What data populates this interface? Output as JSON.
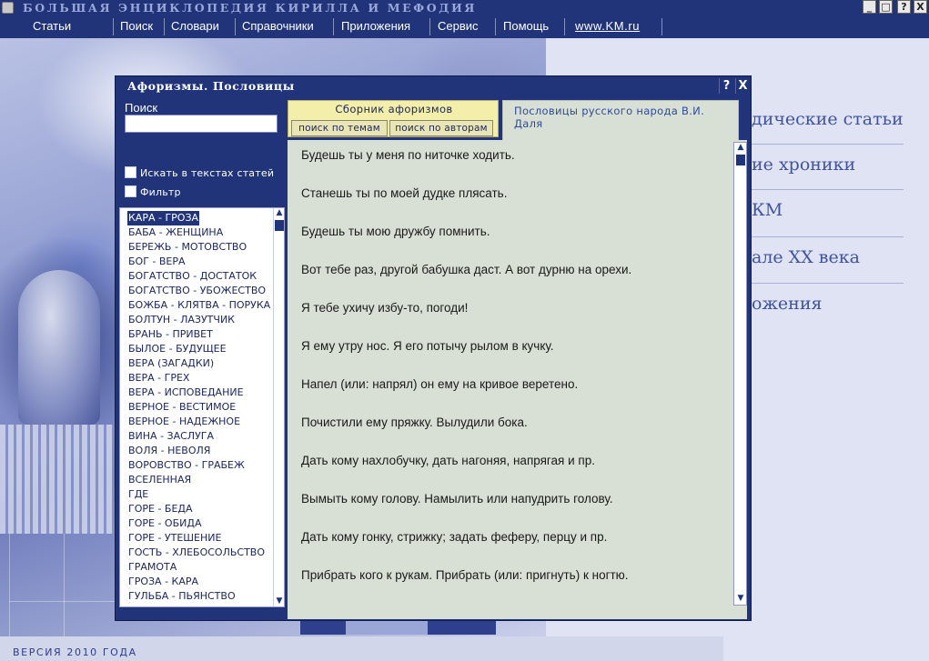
{
  "app": {
    "title": "БОЛЬШАЯ ЭНЦИКЛОПЕДИЯ КИРИЛЛА И МЕФОДИЯ",
    "window_buttons": [
      "_",
      "□",
      "?",
      "X"
    ],
    "version": "ВЕРСИЯ 2010 ГОДА"
  },
  "menu": [
    "Статьи",
    "Поиск",
    "Словари",
    "Справочники",
    "Приложения",
    "Сервис",
    "Помощь",
    "www.KM.ru"
  ],
  "background_links": [
    "дические статьи",
    "ие хроники",
    "КМ",
    "але XX века",
    "ожения"
  ],
  "dialog": {
    "title": "Афоризмы. Пословицы",
    "help": "?",
    "close": "X",
    "search": {
      "label": "Поиск",
      "value": "",
      "options": [
        {
          "label": "Искать в текстах статей",
          "checked": false
        },
        {
          "label": "Фильтр",
          "checked": false
        }
      ]
    },
    "topics": [
      "КАРА - ГРОЗА",
      "БАБА - ЖЕНЩИНА",
      "БЕРЕЖЬ - МОТОВСТВО",
      "БОГ - ВЕРА",
      "БОГАТСТВО - ДОСТАТОК",
      "БОГАТСТВО - УБОЖЕСТВО",
      "БОЖБА - КЛЯТВА - ПОРУКА",
      "БОЛТУН - ЛАЗУТЧИК",
      "БРАНЬ - ПРИВЕТ",
      "БЫЛОЕ - БУДУЩЕЕ",
      "ВЕРА (ЗАГАДКИ)",
      "ВЕРА - ГРЕХ",
      "ВЕРА - ИСПОВЕДАНИЕ",
      "ВЕРНОЕ - ВЕСТИМОЕ",
      "ВЕРНОЕ - НАДЕЖНОЕ",
      "ВИНА - ЗАСЛУГА",
      "ВОЛЯ - НЕВОЛЯ",
      "ВОРОВСТВО - ГРАБЕЖ",
      "ВСЕЛЕННАЯ",
      "ГДЕ",
      "ГОРЕ - БЕДА",
      "ГОРЕ - ОБИДА",
      "ГОРЕ - УТЕШЕНИЕ",
      "ГОСТЬ - ХЛЕБОСОЛЬСТВО",
      "ГРАМОТА",
      "ГРОЗА - КАРА",
      "ГУЛЬБА - ПЬЯНСТВО"
    ],
    "selected_topic_index": 0,
    "tabs": {
      "group_title": "Сборник афоризмов",
      "subtabs": [
        "поиск по темам",
        "поиск по авторам"
      ],
      "active_tab": "Пословицы русского народа В.И. Даля"
    },
    "proverbs": [
      "Будешь ты у меня по ниточке ходить.",
      "Станешь ты по моей дудке плясать.",
      "Будешь ты мою дружбу помнить.",
      "Вот тебе раз, другой бабушка даст. А вот дурню на орехи.",
      "Я тебе ухичу избу-то, погоди!",
      "Я ему утру нос. Я его потычу рылом в кучку.",
      "Напел (или: напрял) он ему на кривое веретено.",
      "Почистили ему пряжку. Вылудили бока.",
      "Дать кому нахлобучку, дать нагоняя, напрягая и пр.",
      "Вымыть кому голову. Намылить или напудрить голову.",
      "Дать кому гонку, стрижку; задать феферу, перцу и пр.",
      "Прибрать кого к рукам. Прибрать (или: пригнуть) к ногтю."
    ]
  },
  "colors": {
    "chrome_blue": "#21347a",
    "content_bg": "#d8dfd4",
    "tab_yellow": "#f3eeaa",
    "link_blue": "#41539e"
  }
}
